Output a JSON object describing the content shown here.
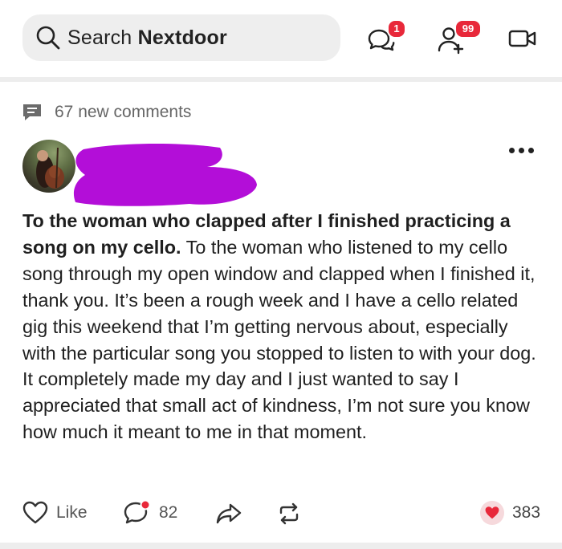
{
  "topbar": {
    "search_label": "Search",
    "search_brand": "Nextdoor",
    "messages_badge": "1",
    "notifications_badge": "99"
  },
  "post": {
    "new_comments": "67 new comments",
    "title": "To the woman who clapped after I finished practicing a song on my cello.",
    "body": "To the woman who listened to my cello song through my open window and clapped when I finished it, thank you. It’s been a rough week and I have a cello related gig this weekend that I’m getting nervous about, especially with the particular song you stopped to listen to with your dog. It completely made my day and I just wanted to say I appreciated that small act of kindness, I’m not sure you know how much it meant to me in that moment."
  },
  "actions": {
    "like_label": "Like",
    "comment_count": "82",
    "reaction_count": "383"
  },
  "colors": {
    "badge": "#e8283a",
    "redaction": "#b30ed8",
    "heart": "#e8283a"
  }
}
